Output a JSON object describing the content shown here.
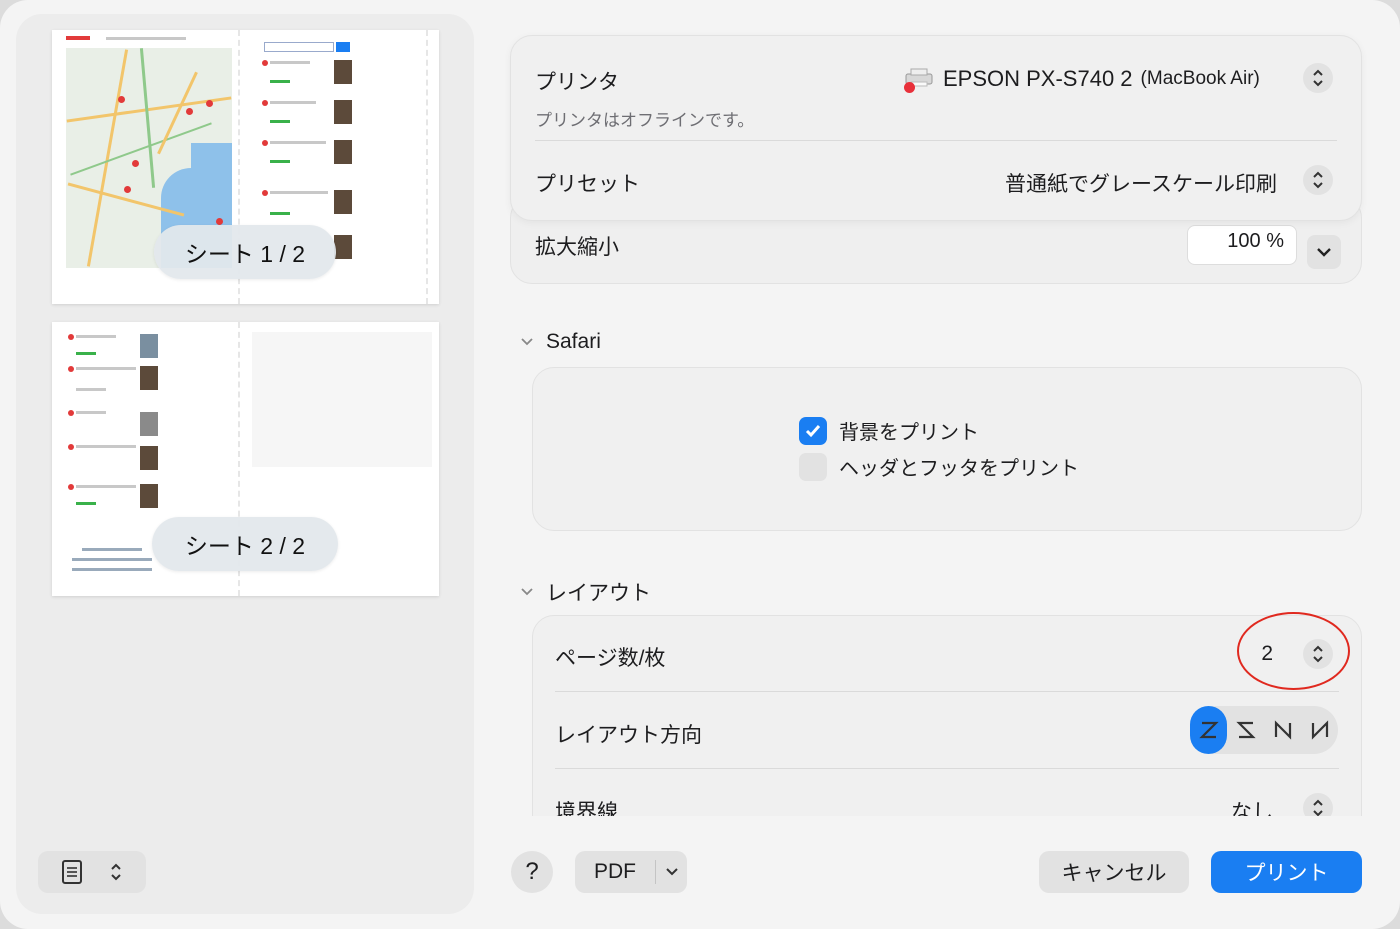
{
  "preview": {
    "sheet1_label": "シート 1 / 2",
    "sheet2_label": "シート 2 / 2"
  },
  "printer": {
    "label": "プリンタ",
    "name": "EPSON PX-S740 2",
    "name_suffix": "(MacBook Air)",
    "status": "プリンタはオフラインです。"
  },
  "preset": {
    "label": "プリセット",
    "value": "普通紙でグレースケール印刷"
  },
  "scale": {
    "label": "拡大縮小",
    "value": "100 %"
  },
  "safari": {
    "section_label": "Safari",
    "print_background_label": "背景をプリント",
    "print_background_checked": true,
    "print_headers_label": "ヘッダとフッタをプリント",
    "print_headers_checked": false
  },
  "layout": {
    "section_label": "レイアウト",
    "pages_per_sheet_label": "ページ数/枚",
    "pages_per_sheet_value": "2",
    "direction_label": "レイアウト方向",
    "border_label": "境界線",
    "border_value": "なし"
  },
  "buttons": {
    "help": "?",
    "pdf": "PDF",
    "cancel": "キャンセル",
    "print": "プリント"
  },
  "colors": {
    "accent": "#1a7ef2",
    "annotation_red": "#e0291f",
    "offline_dot": "#e8303a"
  }
}
